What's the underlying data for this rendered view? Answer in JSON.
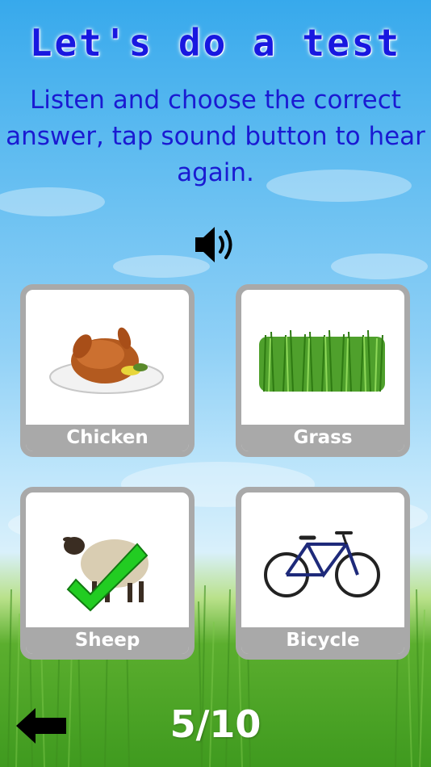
{
  "header": {
    "title": "Let's do a test",
    "instructions": "Listen and choose the correct answer, tap sound button to hear again."
  },
  "controls": {
    "sound_icon": "speaker-icon",
    "back_icon": "left-arrow-icon"
  },
  "options": [
    {
      "label": "Chicken",
      "image": "roast-chicken-image",
      "selected_correct": false
    },
    {
      "label": "Grass",
      "image": "grass-image",
      "selected_correct": false
    },
    {
      "label": "Sheep",
      "image": "sheep-image",
      "selected_correct": true
    },
    {
      "label": "Bicycle",
      "image": "bicycle-image",
      "selected_correct": false
    }
  ],
  "progress": {
    "counter": "5/10",
    "current": 5,
    "total": 10
  },
  "colors": {
    "title": "#1818e0",
    "instructions": "#1a1ad2",
    "card_border": "#a9a9a9",
    "checkmark": "#22cc22"
  }
}
